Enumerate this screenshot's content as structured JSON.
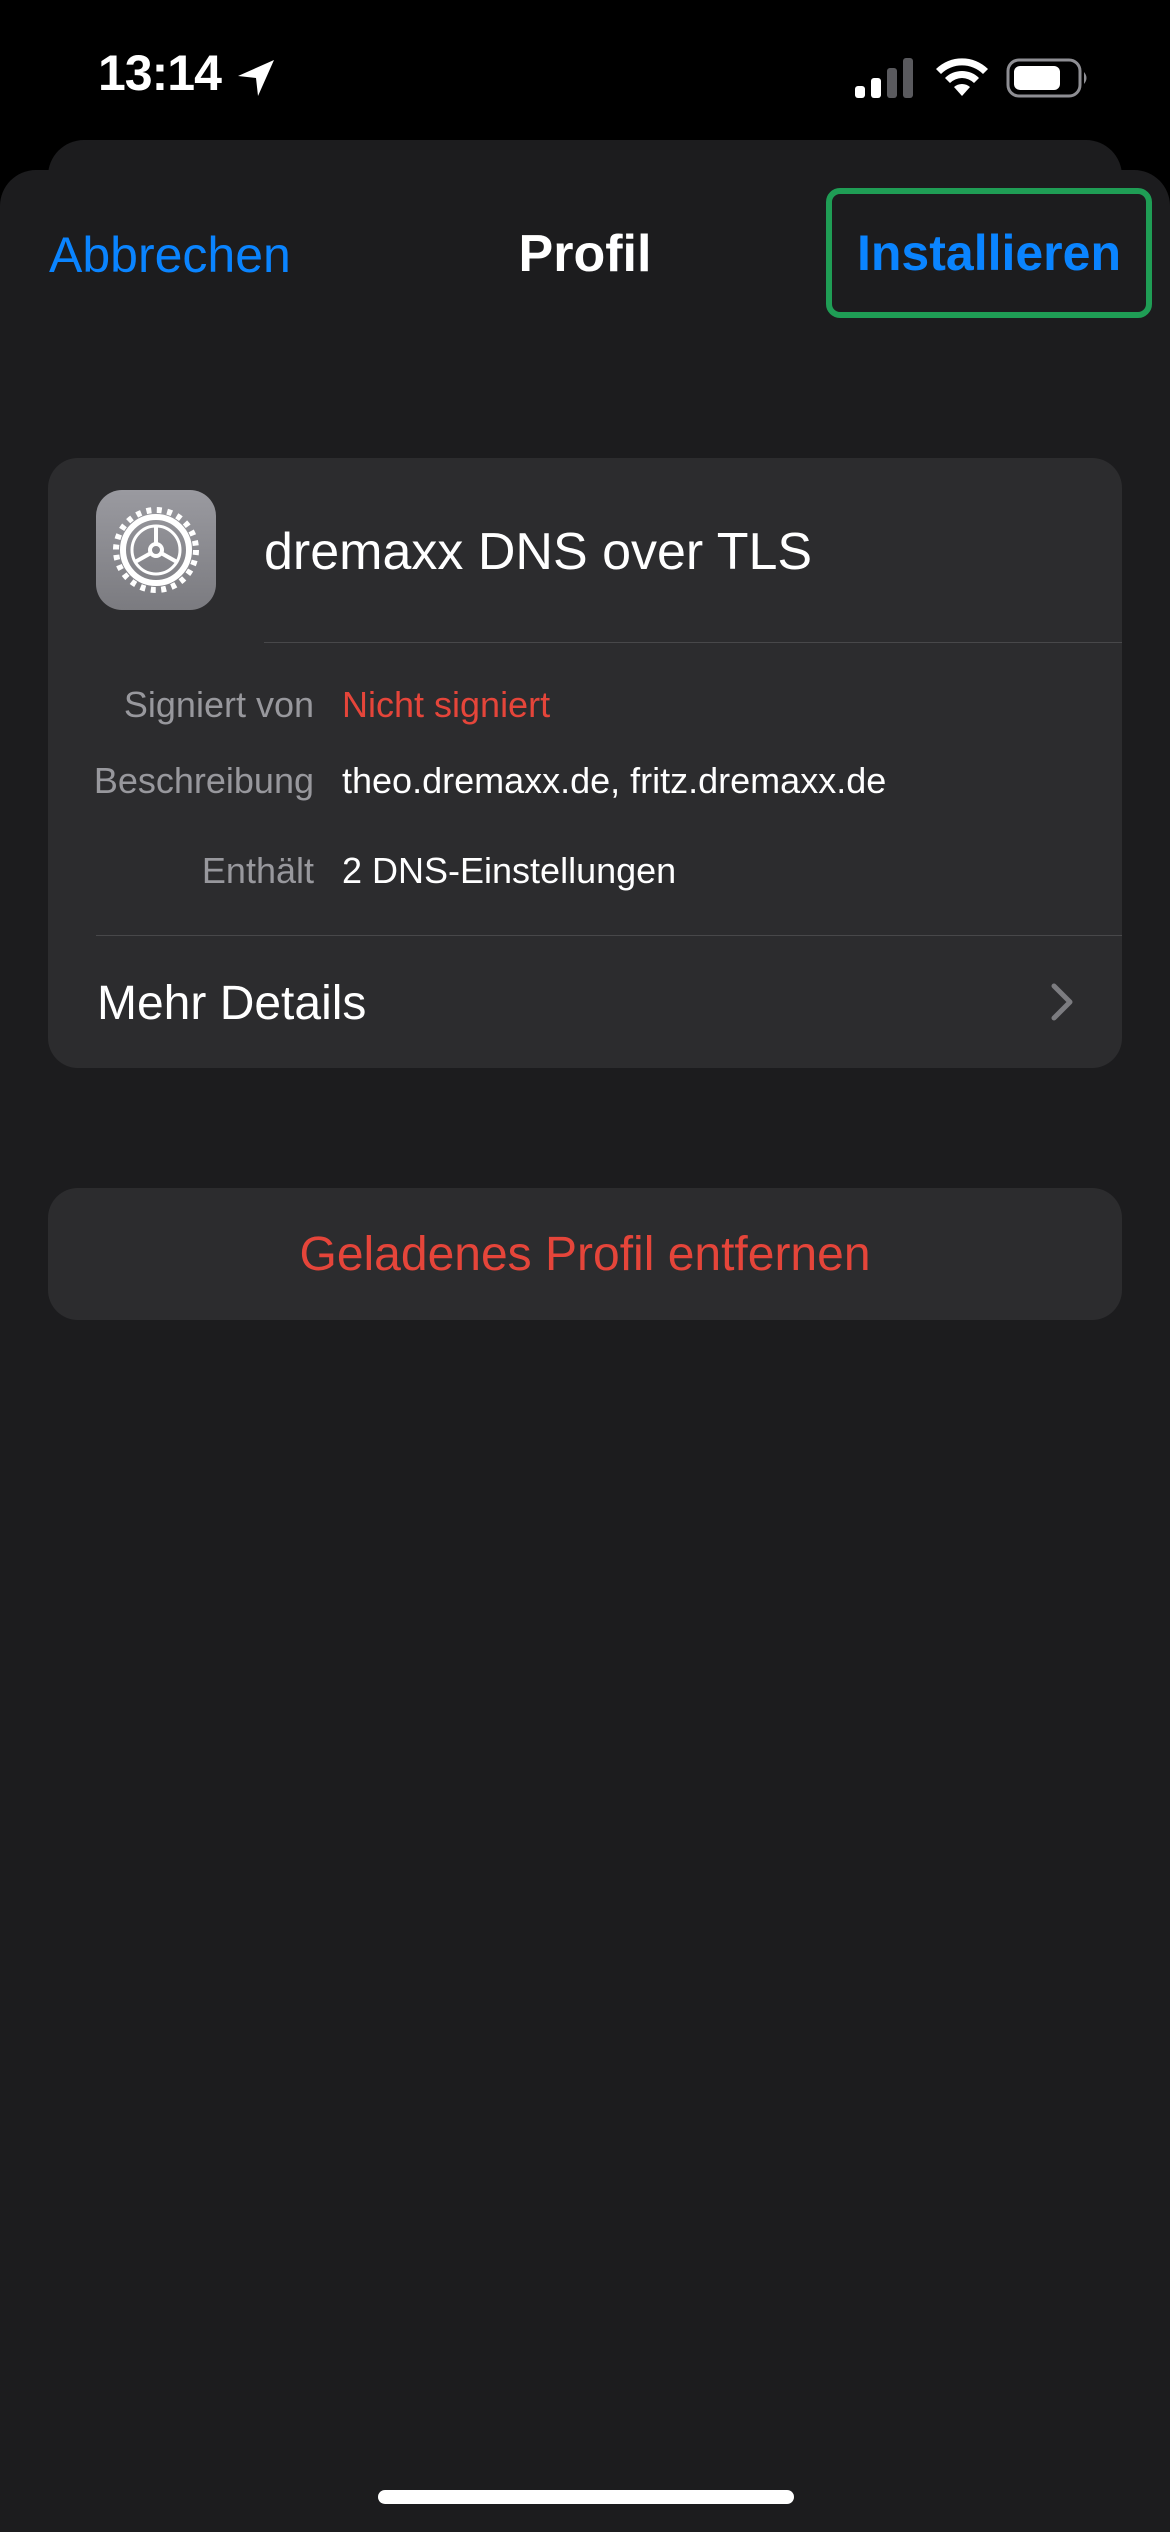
{
  "status_bar": {
    "time": "13:14",
    "location_icon": "location-arrow-icon",
    "signal_icon": "cellular-signal-icon",
    "wifi_icon": "wifi-icon",
    "battery_icon": "battery-icon"
  },
  "nav": {
    "cancel_label": "Abbrechen",
    "title": "Profil",
    "install_label": "Installieren"
  },
  "profile": {
    "icon": "settings-gear-icon",
    "name": "dremaxx DNS over TLS",
    "details": [
      {
        "label": "Signiert von",
        "value": "Nicht signiert"
      },
      {
        "label": "Beschreibung",
        "value": "theo.dremaxx.de, fritz.dremaxx.de"
      },
      {
        "label": "Enthält",
        "value": "2 DNS-Einstellungen"
      }
    ],
    "more_details_label": "Mehr Details"
  },
  "remove_profile_label": "Geladenes Profil entfernen",
  "colors": {
    "accent": "#0a84ff",
    "destructive": "#e5453a",
    "highlight_border": "#1f9d55",
    "background": "#1c1c1e",
    "card": "#2c2c2e"
  }
}
